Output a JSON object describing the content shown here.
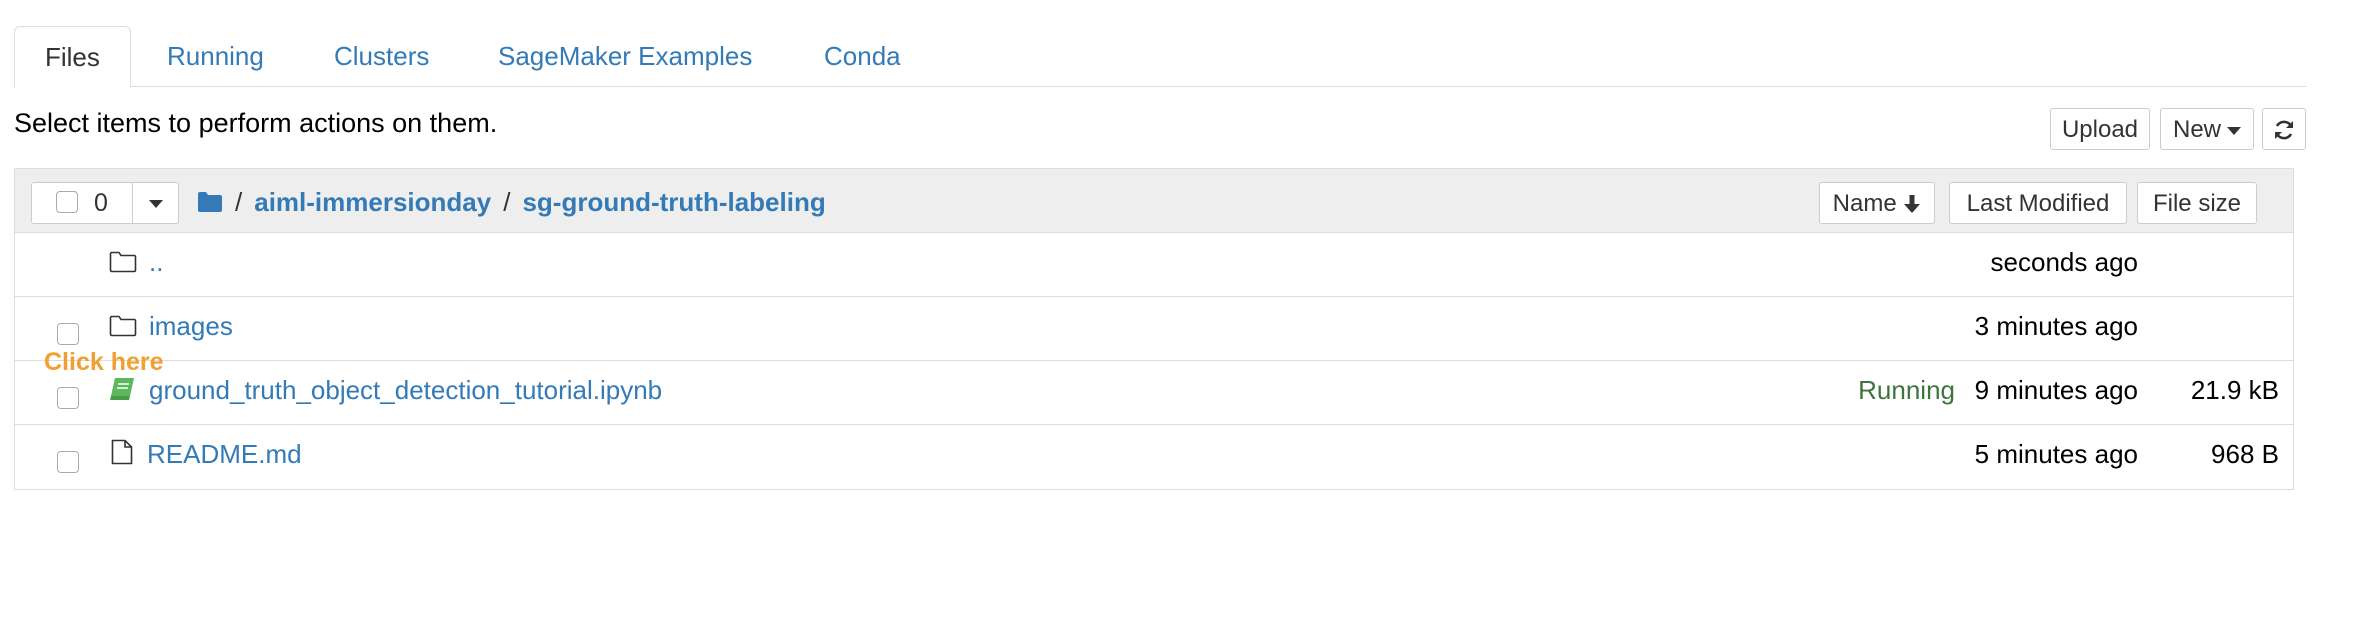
{
  "tabs": [
    {
      "label": "Files",
      "active": true
    },
    {
      "label": "Running",
      "active": false
    },
    {
      "label": "Clusters",
      "active": false
    },
    {
      "label": "SageMaker Examples",
      "active": false
    },
    {
      "label": "Conda",
      "active": false
    }
  ],
  "toolbar": {
    "instructions": "Select items to perform actions on them.",
    "upload_label": "Upload",
    "new_label": "New",
    "refresh_icon": "refresh-icon"
  },
  "list_header": {
    "selected_count": "0",
    "breadcrumb": [
      "aiml-immersionday",
      "sg-ground-truth-labeling"
    ],
    "sort_name_label": "Name",
    "sort_modified_label": "Last Modified",
    "sort_size_label": "File size"
  },
  "items": [
    {
      "name": "..",
      "type": "folder",
      "status": "",
      "modified": "seconds ago",
      "size": ""
    },
    {
      "name": "images",
      "type": "folder",
      "status": "",
      "modified": "3 minutes ago",
      "size": ""
    },
    {
      "name": "ground_truth_object_detection_tutorial.ipynb",
      "type": "notebook",
      "status": "Running",
      "modified": "9 minutes ago",
      "size": "21.9 kB"
    },
    {
      "name": "README.md",
      "type": "file",
      "status": "",
      "modified": "5 minutes ago",
      "size": "968 B"
    }
  ],
  "annotation": {
    "click_here": "Click here"
  },
  "colors": {
    "link": "#337ab7",
    "running": "#3c763d",
    "annotation": "#f0a030",
    "header_bg": "#eeeeee",
    "notebook_icon": "#5cb85c"
  }
}
